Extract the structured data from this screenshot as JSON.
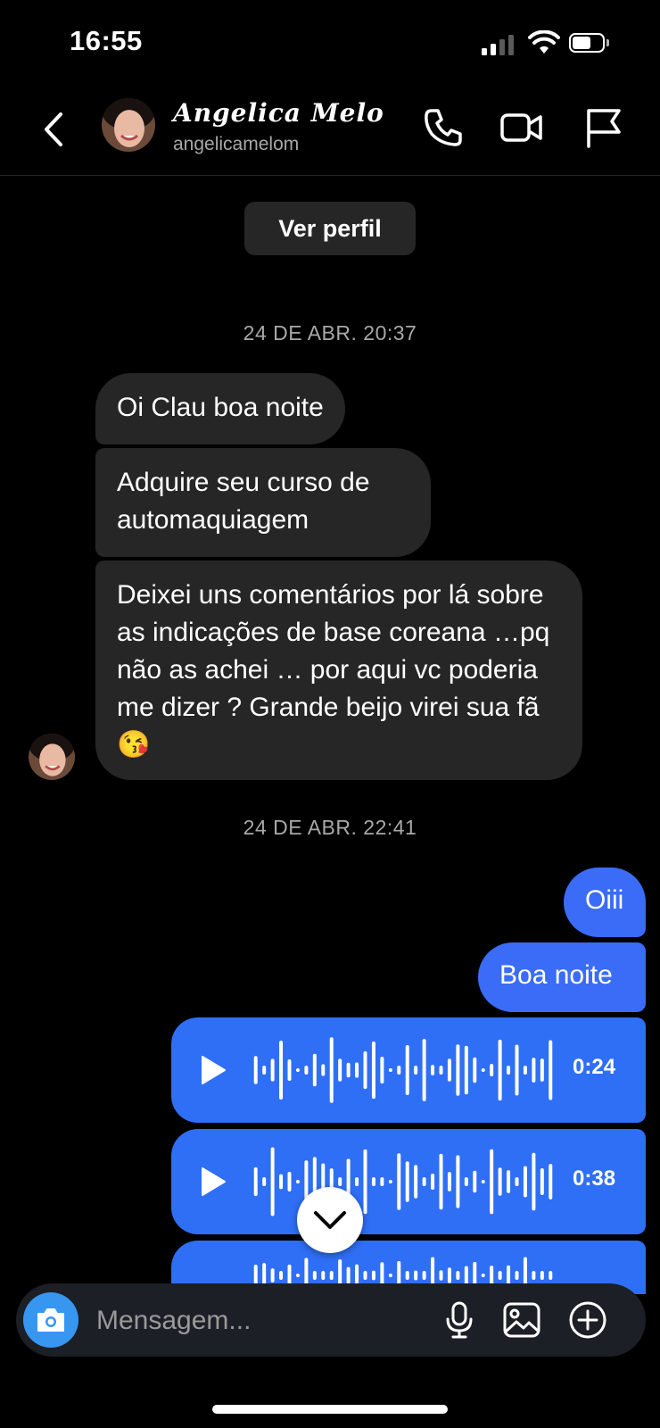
{
  "status_bar": {
    "time": "16:55"
  },
  "header": {
    "name": "Angelica Melo",
    "username": "angelicamelom"
  },
  "view_profile_label": "Ver perfil",
  "conversation": {
    "timestamp_1": "24 DE ABR. 20:37",
    "incoming": [
      "Oi Clau boa noite",
      "Adquire seu curso de automaquiagem",
      "Deixei uns comentários por lá sobre as indicações de base coreana …pq não as achei … por aqui vc poderia me dizer ? Grande beijo virei sua fã 😘"
    ],
    "timestamp_2": "24 DE ABR. 22:41",
    "outgoing": [
      "Oiii",
      "Boa noite"
    ],
    "audio_messages": [
      {
        "duration": "0:24"
      },
      {
        "duration": "0:38"
      }
    ]
  },
  "composer": {
    "placeholder": "Mensagem..."
  },
  "colors": {
    "background": "#000000",
    "incoming_bubble": "#262626",
    "outgoing_bubble": "#3b6cf7",
    "camera_button": "#3797f0"
  },
  "icons": [
    "back-icon",
    "phone-icon",
    "video-icon",
    "flag-icon",
    "play-icon",
    "chevron-down-icon",
    "camera-icon",
    "mic-icon",
    "gallery-icon",
    "plus-icon"
  ]
}
